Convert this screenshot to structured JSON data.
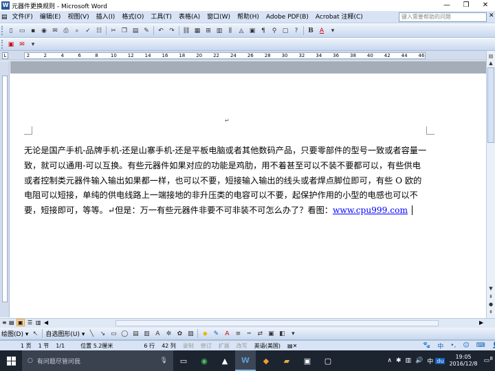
{
  "window": {
    "title": "元器件更换规则 - Microsoft Word",
    "min": "—",
    "restore": "❐",
    "close": "✕"
  },
  "menu": {
    "items": [
      "文件(F)",
      "编辑(E)",
      "视图(V)",
      "插入(I)",
      "格式(O)",
      "工具(T)",
      "表格(A)",
      "窗口(W)",
      "帮助(H)",
      "Adobe PDF(B)",
      "Acrobat 注释(C)"
    ],
    "help_placeholder": "键入需要帮助的问题",
    "close_doc": "✕"
  },
  "ruler": {
    "numbers": [
      "2",
      "2",
      "4",
      "6",
      "8",
      "10",
      "12",
      "14",
      "16",
      "18",
      "20",
      "22",
      "24",
      "26",
      "28",
      "30",
      "32",
      "34",
      "36",
      "38",
      "40",
      "42",
      "44",
      "46"
    ]
  },
  "document": {
    "paragraph_mark": "↵",
    "text": "无论是国产手机-品牌手机-还是山寨手机-还是平板电脑或者其他数码产品，只要零部件的型号一致或者容量一致，就可以通用-可以互换。有些元器件如果对应的功能是鸡肋，用不着甚至可以不装不要都可以，有些供电或者控制类元器件输入输出如果都一样，也可以不要，短接输入输出的线头或者焊点脚位即可，有些 O 欧的电阻可以短接，单纯的供电线路上一端接地的非升压类的电容可以不要，起保护作用的小型的电感也可以不要，短接即可，等等。↵但是：万一有些元器件非要不可非装不可怎么办了？看图：",
    "link": "www.cpu999.com"
  },
  "drawing": {
    "draw_label": "绘图(D) ▾",
    "autoshapes_label": "自选图形(U) ▾"
  },
  "status": {
    "page": "1 页",
    "section": "1 节",
    "page_of": "1/1",
    "position": "位置 5.2厘米",
    "line": "6 行",
    "column": "42 列",
    "rec": "录制",
    "trk": "修订",
    "ext": "扩展",
    "ovr": "改写",
    "language": "英语(美国)"
  },
  "taskbar": {
    "search_placeholder": "有问题尽管问我",
    "time": "19:05",
    "date": "2016/12/8",
    "ime": "中",
    "notification_count": "8"
  },
  "colors": {
    "accent": "#2b579a",
    "link": "#0000ff",
    "toolbar": "#c7d8ef",
    "taskbar": "#1c2430"
  }
}
